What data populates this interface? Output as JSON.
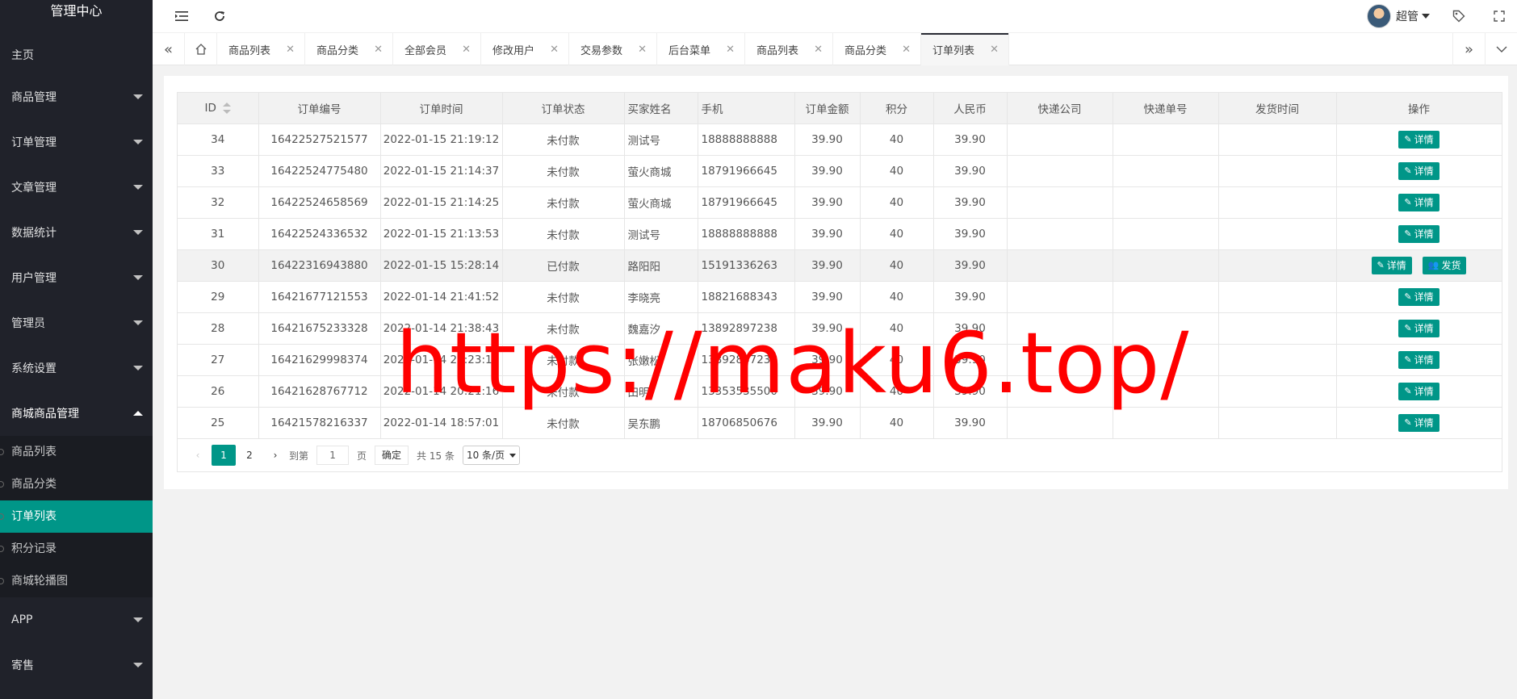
{
  "sidebar": {
    "logo": "管理中心",
    "items": [
      {
        "label": "主页"
      },
      {
        "label": "商品管理"
      },
      {
        "label": "订单管理"
      },
      {
        "label": "文章管理"
      },
      {
        "label": "数据统计"
      },
      {
        "label": "用户管理"
      },
      {
        "label": "管理员"
      },
      {
        "label": "系统设置"
      },
      {
        "label": "商城商品管理"
      }
    ],
    "sub_items": [
      {
        "label": "商品列表"
      },
      {
        "label": "商品分类"
      },
      {
        "label": "订单列表"
      },
      {
        "label": "积分记录"
      },
      {
        "label": "商城轮播图"
      }
    ],
    "after_items": [
      {
        "label": "APP"
      },
      {
        "label": "寄售"
      }
    ]
  },
  "header": {
    "user_name": "超管"
  },
  "tabs": [
    {
      "label": "商品列表"
    },
    {
      "label": "商品分类"
    },
    {
      "label": "全部会员"
    },
    {
      "label": "修改用户"
    },
    {
      "label": "交易参数"
    },
    {
      "label": "后台菜单"
    },
    {
      "label": "商品列表"
    },
    {
      "label": "商品分类"
    },
    {
      "label": "订单列表"
    }
  ],
  "table": {
    "columns": [
      "ID",
      "订单编号",
      "订单时间",
      "订单状态",
      "买家姓名",
      "手机",
      "订单金额",
      "积分",
      "人民币",
      "快递公司",
      "快递单号",
      "发货时间",
      "操作"
    ],
    "detail_label": "详情",
    "ship_label": "发货",
    "rows": [
      {
        "id": "34",
        "no": "16422527521577",
        "time": "2022-01-15 21:19:12",
        "status": "未付款",
        "buyer": "测试号",
        "phone": "18888888888",
        "amount": "39.90",
        "points": "40",
        "rmb": "39.90"
      },
      {
        "id": "33",
        "no": "16422524775480",
        "time": "2022-01-15 21:14:37",
        "status": "未付款",
        "buyer": "萤火商城",
        "phone": "18791966645",
        "amount": "39.90",
        "points": "40",
        "rmb": "39.90"
      },
      {
        "id": "32",
        "no": "16422524658569",
        "time": "2022-01-15 21:14:25",
        "status": "未付款",
        "buyer": "萤火商城",
        "phone": "18791966645",
        "amount": "39.90",
        "points": "40",
        "rmb": "39.90"
      },
      {
        "id": "31",
        "no": "16422524336532",
        "time": "2022-01-15 21:13:53",
        "status": "未付款",
        "buyer": "测试号",
        "phone": "18888888888",
        "amount": "39.90",
        "points": "40",
        "rmb": "39.90"
      },
      {
        "id": "30",
        "no": "16422316943880",
        "time": "2022-01-15 15:28:14",
        "status": "已付款",
        "buyer": "路阳阳",
        "phone": "15191336263",
        "amount": "39.90",
        "points": "40",
        "rmb": "39.90"
      },
      {
        "id": "29",
        "no": "16421677121553",
        "time": "2022-01-14 21:41:52",
        "status": "未付款",
        "buyer": "李晓亮",
        "phone": "18821688343",
        "amount": "39.90",
        "points": "40",
        "rmb": "39.90"
      },
      {
        "id": "28",
        "no": "16421675233328",
        "time": "2022-01-14 21:38:43",
        "status": "未付款",
        "buyer": "魏嘉汐",
        "phone": "13892897238",
        "amount": "39.90",
        "points": "40",
        "rmb": "39.90"
      },
      {
        "id": "27",
        "no": "16421629998374",
        "time": "2022-01-14 20:23:19",
        "status": "未付款",
        "buyer": "张嫩松",
        "phone": "13892847238",
        "amount": "39.90",
        "points": "40",
        "rmb": "39.90"
      },
      {
        "id": "26",
        "no": "16421628767712",
        "time": "2022-01-14 20:21:16",
        "status": "未付款",
        "buyer": "田明",
        "phone": "13353535500",
        "amount": "39.90",
        "points": "40",
        "rmb": "39.90"
      },
      {
        "id": "25",
        "no": "16421578216337",
        "time": "2022-01-14 18:57:01",
        "status": "未付款",
        "buyer": "吴东鹏",
        "phone": "18706850676",
        "amount": "39.90",
        "points": "40",
        "rmb": "39.90"
      }
    ]
  },
  "pager": {
    "page1": "1",
    "page2": "2",
    "goto_label": "到第",
    "page_input": "1",
    "page_unit": "页",
    "confirm": "确定",
    "total": "共 15 条",
    "per_page": "10 条/页"
  },
  "watermark": "https://maku6.top/"
}
